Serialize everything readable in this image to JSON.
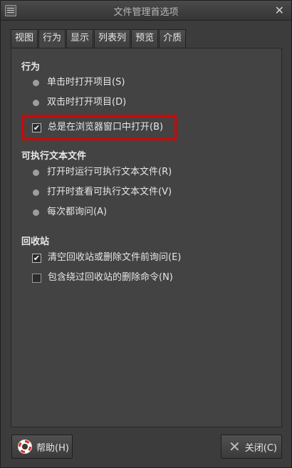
{
  "window": {
    "title": "文件管理首选项"
  },
  "tabs": [
    {
      "label": "视图",
      "active": false
    },
    {
      "label": "行为",
      "active": true
    },
    {
      "label": "显示",
      "active": false
    },
    {
      "label": "列表列",
      "active": false
    },
    {
      "label": "预览",
      "active": false
    },
    {
      "label": "介质",
      "active": false
    }
  ],
  "behavior": {
    "title": "行为",
    "click_single": "单击时打开项目(S)",
    "click_double": "双击时打开项目(D)",
    "open_in_browser": "总是在浏览器窗口中打开(B)"
  },
  "executables": {
    "title": "可执行文本文件",
    "run": "打开时运行可执行文本文件(R)",
    "view": "打开时查看可执行文本文件(V)",
    "ask": "每次都询问(A)"
  },
  "trash": {
    "title": "回收站",
    "confirm": "清空回收站或删除文件前询问(E)",
    "include_delete": "包含绕过回收站的删除命令(N)"
  },
  "buttons": {
    "help": "帮助(H)",
    "close": "关闭(C)"
  },
  "colors": {
    "highlight": "#d80000",
    "background": "#3c3c3c"
  }
}
